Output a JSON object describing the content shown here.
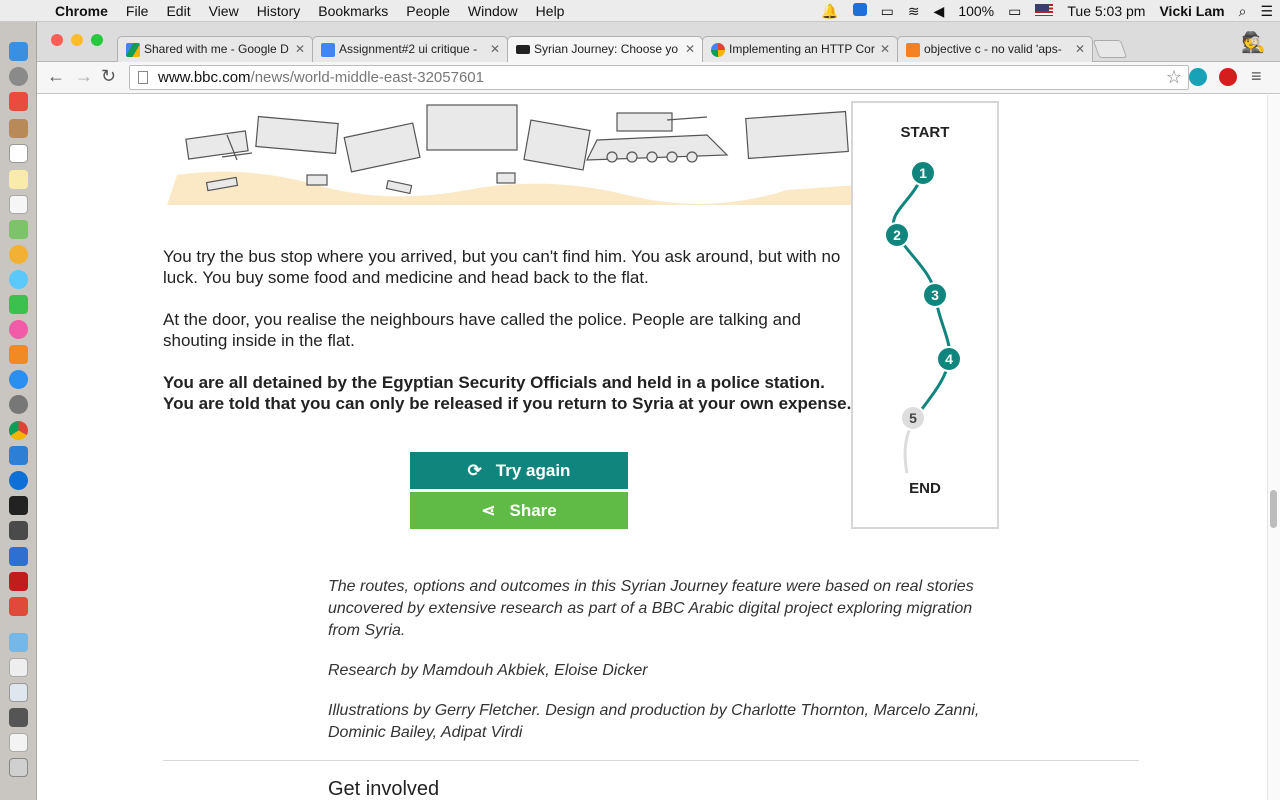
{
  "menubar": {
    "app_name": "Chrome",
    "items": [
      "File",
      "Edit",
      "View",
      "History",
      "Bookmarks",
      "People",
      "Window",
      "Help"
    ],
    "battery": "100%",
    "clock": "Tue 5:03 pm",
    "user": "Vicki Lam"
  },
  "tabs": [
    {
      "title": "Shared with me - Google D",
      "favicon_color": "#1fa463"
    },
    {
      "title": "Assignment#2 ui critique -",
      "favicon_color": "#4285f4"
    },
    {
      "title": "Syrian Journey: Choose yo",
      "favicon_color": "#222222"
    },
    {
      "title": "Implementing an HTTP Cor",
      "favicon_color": "#34a853"
    },
    {
      "title": "objective c - no valid 'aps-",
      "favicon_color": "#f48024"
    }
  ],
  "url": {
    "host": "www.bbc.com",
    "path": "/news/world-middle-east-32057601"
  },
  "story": {
    "p1": "You try the bus stop where you arrived, but you can't find him. You ask around, but with no luck. You buy some food and medicine and head back to the flat.",
    "p2": "At the door, you realise the neighbours have called the police. People are talking and shouting inside in the flat.",
    "p3": "You are all detained by the Egyptian Security Officials and held in a police station. You are told that you can only be released if you return to Syria at your own expense."
  },
  "buttons": {
    "try_again": "Try again",
    "share": "Share"
  },
  "route": {
    "start_label": "START",
    "end_label": "END",
    "steps": [
      "1",
      "2",
      "3",
      "4",
      "5"
    ],
    "completed_steps": 4,
    "active_color": "#10857d",
    "inactive_color": "#dddddd"
  },
  "credits": {
    "c1": "The routes, options and outcomes in this Syrian Journey feature were based on real stories uncovered by extensive research as part of a BBC Arabic digital project exploring migration from Syria.",
    "c2": "Research by Mamdouh Akbiek, Eloise Dicker",
    "c3": "Illustrations by Gerry Fletcher. Design and production by Charlotte Thornton, Marcelo Zanni, Dominic Bailey, Adipat Virdi"
  },
  "section_heading": "Get involved"
}
